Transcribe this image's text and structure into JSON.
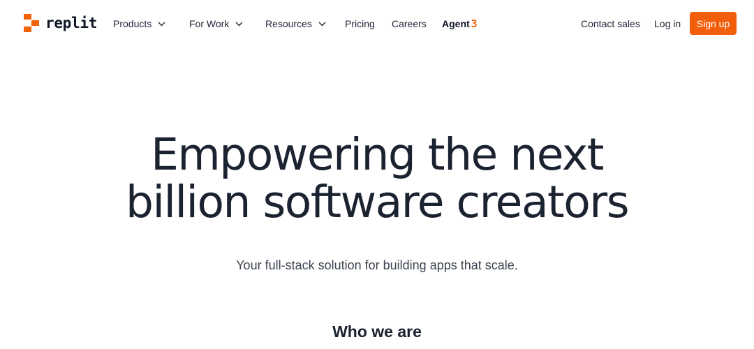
{
  "brand": {
    "name": "replit",
    "accent_color": "#F26207",
    "logo_icon": "replit-logo-icon"
  },
  "nav": {
    "items": [
      {
        "label": "Products",
        "has_dropdown": true
      },
      {
        "label": "For Work",
        "has_dropdown": true
      },
      {
        "label": "Resources",
        "has_dropdown": true
      },
      {
        "label": "Pricing",
        "has_dropdown": false
      },
      {
        "label": "Careers",
        "has_dropdown": false
      }
    ],
    "agent": {
      "label": "Agent",
      "version": "3"
    },
    "contact_sales": "Contact sales",
    "login": "Log in",
    "signup": "Sign up",
    "signup_color": "#F25F0C"
  },
  "hero": {
    "title_line1": "Empowering the next",
    "title_line2": "billion software creators",
    "subtitle": "Your full-stack solution for building apps that scale."
  },
  "section": {
    "heading": "Who we are"
  }
}
